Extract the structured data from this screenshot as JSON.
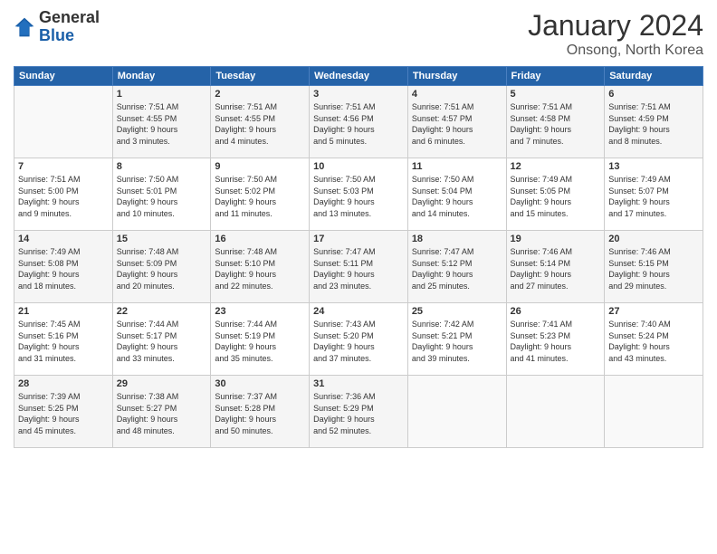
{
  "logo": {
    "general": "General",
    "blue": "Blue"
  },
  "header": {
    "title": "January 2024",
    "subtitle": "Onsong, North Korea"
  },
  "days_of_week": [
    "Sunday",
    "Monday",
    "Tuesday",
    "Wednesday",
    "Thursday",
    "Friday",
    "Saturday"
  ],
  "weeks": [
    [
      {
        "day": "",
        "info": ""
      },
      {
        "day": "1",
        "info": "Sunrise: 7:51 AM\nSunset: 4:55 PM\nDaylight: 9 hours\nand 3 minutes."
      },
      {
        "day": "2",
        "info": "Sunrise: 7:51 AM\nSunset: 4:55 PM\nDaylight: 9 hours\nand 4 minutes."
      },
      {
        "day": "3",
        "info": "Sunrise: 7:51 AM\nSunset: 4:56 PM\nDaylight: 9 hours\nand 5 minutes."
      },
      {
        "day": "4",
        "info": "Sunrise: 7:51 AM\nSunset: 4:57 PM\nDaylight: 9 hours\nand 6 minutes."
      },
      {
        "day": "5",
        "info": "Sunrise: 7:51 AM\nSunset: 4:58 PM\nDaylight: 9 hours\nand 7 minutes."
      },
      {
        "day": "6",
        "info": "Sunrise: 7:51 AM\nSunset: 4:59 PM\nDaylight: 9 hours\nand 8 minutes."
      }
    ],
    [
      {
        "day": "7",
        "info": "Sunrise: 7:51 AM\nSunset: 5:00 PM\nDaylight: 9 hours\nand 9 minutes."
      },
      {
        "day": "8",
        "info": "Sunrise: 7:50 AM\nSunset: 5:01 PM\nDaylight: 9 hours\nand 10 minutes."
      },
      {
        "day": "9",
        "info": "Sunrise: 7:50 AM\nSunset: 5:02 PM\nDaylight: 9 hours\nand 11 minutes."
      },
      {
        "day": "10",
        "info": "Sunrise: 7:50 AM\nSunset: 5:03 PM\nDaylight: 9 hours\nand 13 minutes."
      },
      {
        "day": "11",
        "info": "Sunrise: 7:50 AM\nSunset: 5:04 PM\nDaylight: 9 hours\nand 14 minutes."
      },
      {
        "day": "12",
        "info": "Sunrise: 7:49 AM\nSunset: 5:05 PM\nDaylight: 9 hours\nand 15 minutes."
      },
      {
        "day": "13",
        "info": "Sunrise: 7:49 AM\nSunset: 5:07 PM\nDaylight: 9 hours\nand 17 minutes."
      }
    ],
    [
      {
        "day": "14",
        "info": "Sunrise: 7:49 AM\nSunset: 5:08 PM\nDaylight: 9 hours\nand 18 minutes."
      },
      {
        "day": "15",
        "info": "Sunrise: 7:48 AM\nSunset: 5:09 PM\nDaylight: 9 hours\nand 20 minutes."
      },
      {
        "day": "16",
        "info": "Sunrise: 7:48 AM\nSunset: 5:10 PM\nDaylight: 9 hours\nand 22 minutes."
      },
      {
        "day": "17",
        "info": "Sunrise: 7:47 AM\nSunset: 5:11 PM\nDaylight: 9 hours\nand 23 minutes."
      },
      {
        "day": "18",
        "info": "Sunrise: 7:47 AM\nSunset: 5:12 PM\nDaylight: 9 hours\nand 25 minutes."
      },
      {
        "day": "19",
        "info": "Sunrise: 7:46 AM\nSunset: 5:14 PM\nDaylight: 9 hours\nand 27 minutes."
      },
      {
        "day": "20",
        "info": "Sunrise: 7:46 AM\nSunset: 5:15 PM\nDaylight: 9 hours\nand 29 minutes."
      }
    ],
    [
      {
        "day": "21",
        "info": "Sunrise: 7:45 AM\nSunset: 5:16 PM\nDaylight: 9 hours\nand 31 minutes."
      },
      {
        "day": "22",
        "info": "Sunrise: 7:44 AM\nSunset: 5:17 PM\nDaylight: 9 hours\nand 33 minutes."
      },
      {
        "day": "23",
        "info": "Sunrise: 7:44 AM\nSunset: 5:19 PM\nDaylight: 9 hours\nand 35 minutes."
      },
      {
        "day": "24",
        "info": "Sunrise: 7:43 AM\nSunset: 5:20 PM\nDaylight: 9 hours\nand 37 minutes."
      },
      {
        "day": "25",
        "info": "Sunrise: 7:42 AM\nSunset: 5:21 PM\nDaylight: 9 hours\nand 39 minutes."
      },
      {
        "day": "26",
        "info": "Sunrise: 7:41 AM\nSunset: 5:23 PM\nDaylight: 9 hours\nand 41 minutes."
      },
      {
        "day": "27",
        "info": "Sunrise: 7:40 AM\nSunset: 5:24 PM\nDaylight: 9 hours\nand 43 minutes."
      }
    ],
    [
      {
        "day": "28",
        "info": "Sunrise: 7:39 AM\nSunset: 5:25 PM\nDaylight: 9 hours\nand 45 minutes."
      },
      {
        "day": "29",
        "info": "Sunrise: 7:38 AM\nSunset: 5:27 PM\nDaylight: 9 hours\nand 48 minutes."
      },
      {
        "day": "30",
        "info": "Sunrise: 7:37 AM\nSunset: 5:28 PM\nDaylight: 9 hours\nand 50 minutes."
      },
      {
        "day": "31",
        "info": "Sunrise: 7:36 AM\nSunset: 5:29 PM\nDaylight: 9 hours\nand 52 minutes."
      },
      {
        "day": "",
        "info": ""
      },
      {
        "day": "",
        "info": ""
      },
      {
        "day": "",
        "info": ""
      }
    ]
  ]
}
